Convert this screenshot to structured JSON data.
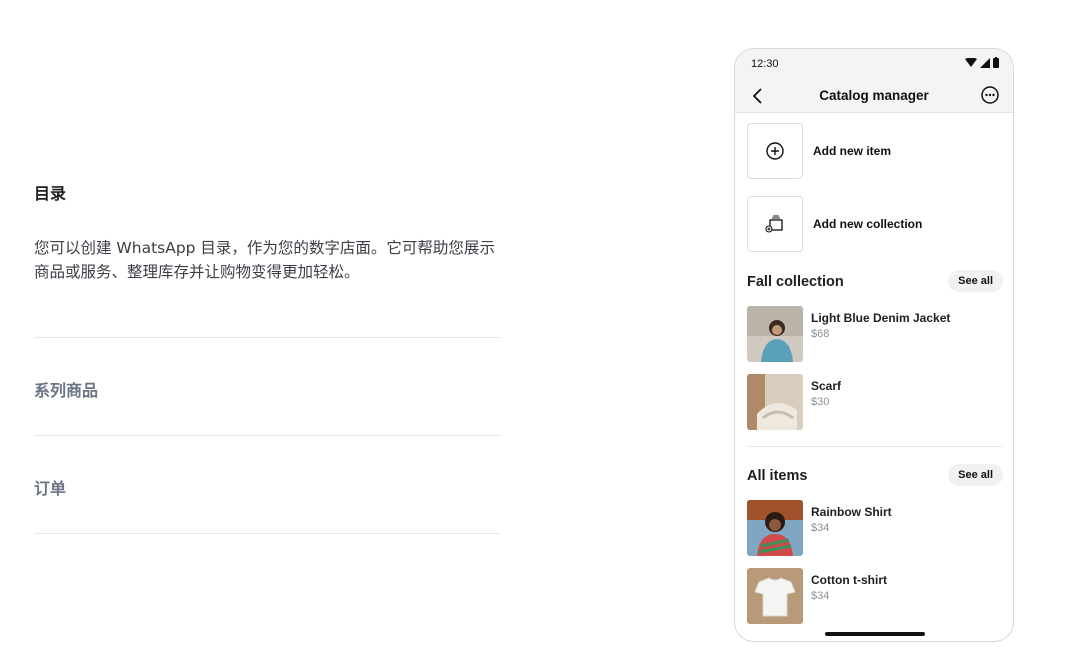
{
  "section": {
    "title": "目录",
    "description": "您可以创建 WhatsApp 目录，作为您的数字店面。它可帮助您展示商品或服务、整理库存并让购物变得更加轻松。",
    "accordion": [
      "系列商品",
      "订单"
    ]
  },
  "phone": {
    "time": "12:30",
    "title": "Catalog manager",
    "actions": [
      {
        "label": "Add new item",
        "icon": "plus-circle-icon"
      },
      {
        "label": "Add new collection",
        "icon": "add-collection-icon"
      }
    ],
    "groups": [
      {
        "title": "Fall collection",
        "see_all": "See all",
        "items": [
          {
            "name": "Light Blue Denim Jacket",
            "price": "$68"
          },
          {
            "name": "Scarf",
            "price": "$30"
          }
        ]
      },
      {
        "title": "All items",
        "see_all": "See all",
        "items": [
          {
            "name": "Rainbow Shirt",
            "price": "$34"
          },
          {
            "name": "Cotton t-shirt",
            "price": "$34"
          }
        ]
      }
    ]
  }
}
